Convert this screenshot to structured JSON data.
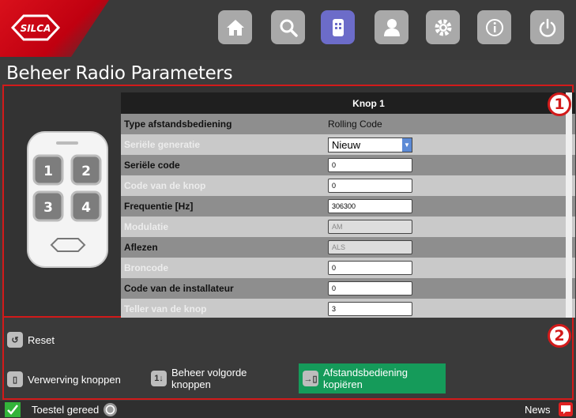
{
  "header": {
    "logo_text": "SILCA",
    "nav": [
      {
        "name": "home",
        "icon": "home-icon"
      },
      {
        "name": "search",
        "icon": "search-icon"
      },
      {
        "name": "remote",
        "icon": "remote-icon",
        "active": true
      },
      {
        "name": "user",
        "icon": "user-icon"
      },
      {
        "name": "settings",
        "icon": "gear-icon"
      },
      {
        "name": "info",
        "icon": "info-icon"
      },
      {
        "name": "power",
        "icon": "power-icon"
      }
    ],
    "active_color": "#6c6cc9"
  },
  "page_title": "Beheer Radio Parameters",
  "remote_keys": [
    "1",
    "2",
    "3",
    "4"
  ],
  "table": {
    "column_header": "Knop 1",
    "rows": [
      {
        "label": "Type afstandsbediening",
        "value": "Rolling Code",
        "kind": "text"
      },
      {
        "label": "Seriële generatie",
        "value": "Nieuw",
        "kind": "select"
      },
      {
        "label": "Seriële code",
        "value": "0",
        "kind": "input"
      },
      {
        "label": "Code van de knop",
        "value": "0",
        "kind": "input"
      },
      {
        "label": "Frequentie [Hz]",
        "value": "306300",
        "kind": "input"
      },
      {
        "label": "Modulatie",
        "value": "AM",
        "kind": "disabled"
      },
      {
        "label": "Aflezen",
        "value": "ALS",
        "kind": "disabled"
      },
      {
        "label": "Broncode",
        "value": "0",
        "kind": "input"
      },
      {
        "label": "Code van de installateur",
        "value": "0",
        "kind": "input"
      },
      {
        "label": "Teller van de knop",
        "value": "3",
        "kind": "input"
      }
    ]
  },
  "badges": {
    "one": "1",
    "two": "2"
  },
  "actions": {
    "reset": "Reset",
    "acquire": "Verwerving knoppen",
    "order_line1": "Beheer volgorde",
    "order_line2": "knoppen",
    "copy_line1": "Afstandsbediening",
    "copy_line2": "kopiëren"
  },
  "status": {
    "text": "Toestel gereed",
    "news": "News"
  },
  "colors": {
    "accent_red": "#d21a1a",
    "copy_green": "#159b5a",
    "ok_green": "#33b43a"
  }
}
